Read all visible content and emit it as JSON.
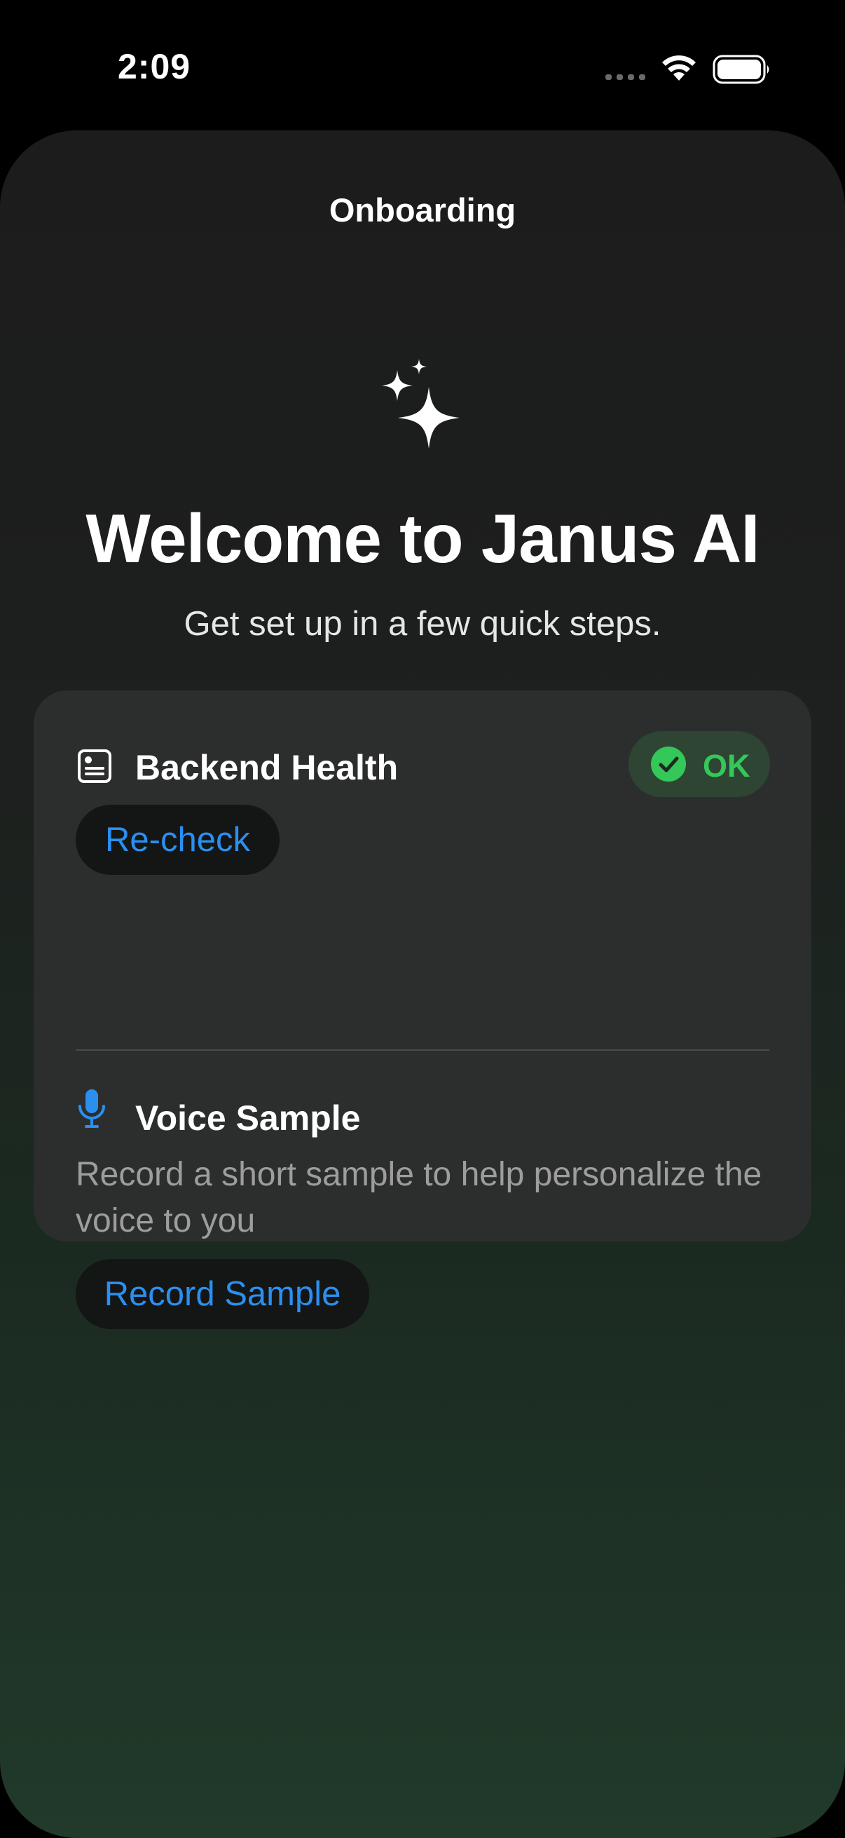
{
  "status_bar": {
    "time": "2:09"
  },
  "nav": {
    "title": "Onboarding"
  },
  "welcome": {
    "title": "Welcome to Janus AI",
    "subtitle": "Get set up in a few quick steps."
  },
  "backend_health": {
    "title": "Backend Health",
    "status": "OK",
    "recheck_label": "Re-check"
  },
  "voice_sample": {
    "title": "Voice Sample",
    "description": "Record a short sample to help personalize the voice to you",
    "record_label": "Record Sample"
  },
  "icons": {
    "sparkles": "sparkles-icon",
    "health": "list-card-icon",
    "mic": "mic-icon",
    "check": "check-circle-icon"
  },
  "colors": {
    "accent_blue": "#2b8ff0",
    "ok_green": "#34c759",
    "card_bg": "#2c2e2d"
  }
}
